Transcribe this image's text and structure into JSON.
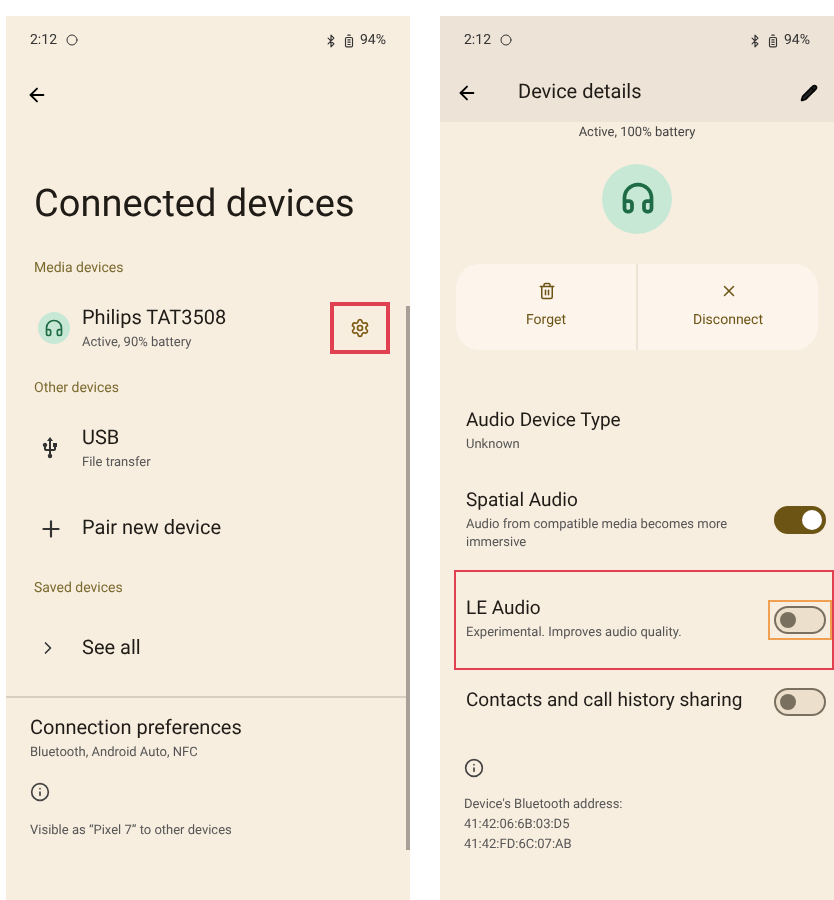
{
  "left_screen": {
    "status_bar": {
      "time": "2:12",
      "battery": "94%"
    },
    "title": "Connected devices",
    "sections": [
      {
        "header": "Media devices",
        "items": [
          {
            "kind": "device",
            "title": "Philips TAT3508",
            "subtitle": "Active, 90% battery",
            "gear_highlighted": true
          }
        ]
      },
      {
        "header": "Other devices",
        "items": [
          {
            "kind": "usb",
            "title": "USB",
            "subtitle": "File transfer"
          },
          {
            "kind": "add",
            "title": "Pair new device"
          }
        ]
      },
      {
        "header": "Saved devices",
        "items": [
          {
            "kind": "expand",
            "title": "See all"
          }
        ]
      }
    ],
    "connection_preferences": {
      "title": "Connection preferences",
      "subtitle": "Bluetooth, Android Auto, NFC"
    },
    "footer": "Visible as “Pixel 7” to other devices"
  },
  "right_screen": {
    "status_bar": {
      "time": "2:12",
      "battery": "94%"
    },
    "toolbar_title": "Device details",
    "device_status": "Active, 100% battery",
    "actions": [
      {
        "kind": "forget",
        "label": "Forget"
      },
      {
        "kind": "disconnect",
        "label": "Disconnect"
      }
    ],
    "settings": [
      {
        "kind": "info",
        "title": "Audio Device Type",
        "subtitle": "Unknown",
        "highlighted": false
      },
      {
        "kind": "toggle",
        "title": "Spatial Audio",
        "subtitle": "Audio from compatible media becomes more immersive",
        "on": true,
        "highlighted": false
      },
      {
        "kind": "toggle",
        "title": "LE Audio",
        "subtitle": "Experimental. Improves audio quality.",
        "on": false,
        "highlighted": true
      },
      {
        "kind": "toggle",
        "title": "Contacts and call history sharing",
        "on": false,
        "highlighted": false
      }
    ],
    "address_label": "Device's Bluetooth address:",
    "addresses": [
      "41:42:06:6B:03:D5",
      "41:42:FD:6C:07:AB"
    ]
  }
}
